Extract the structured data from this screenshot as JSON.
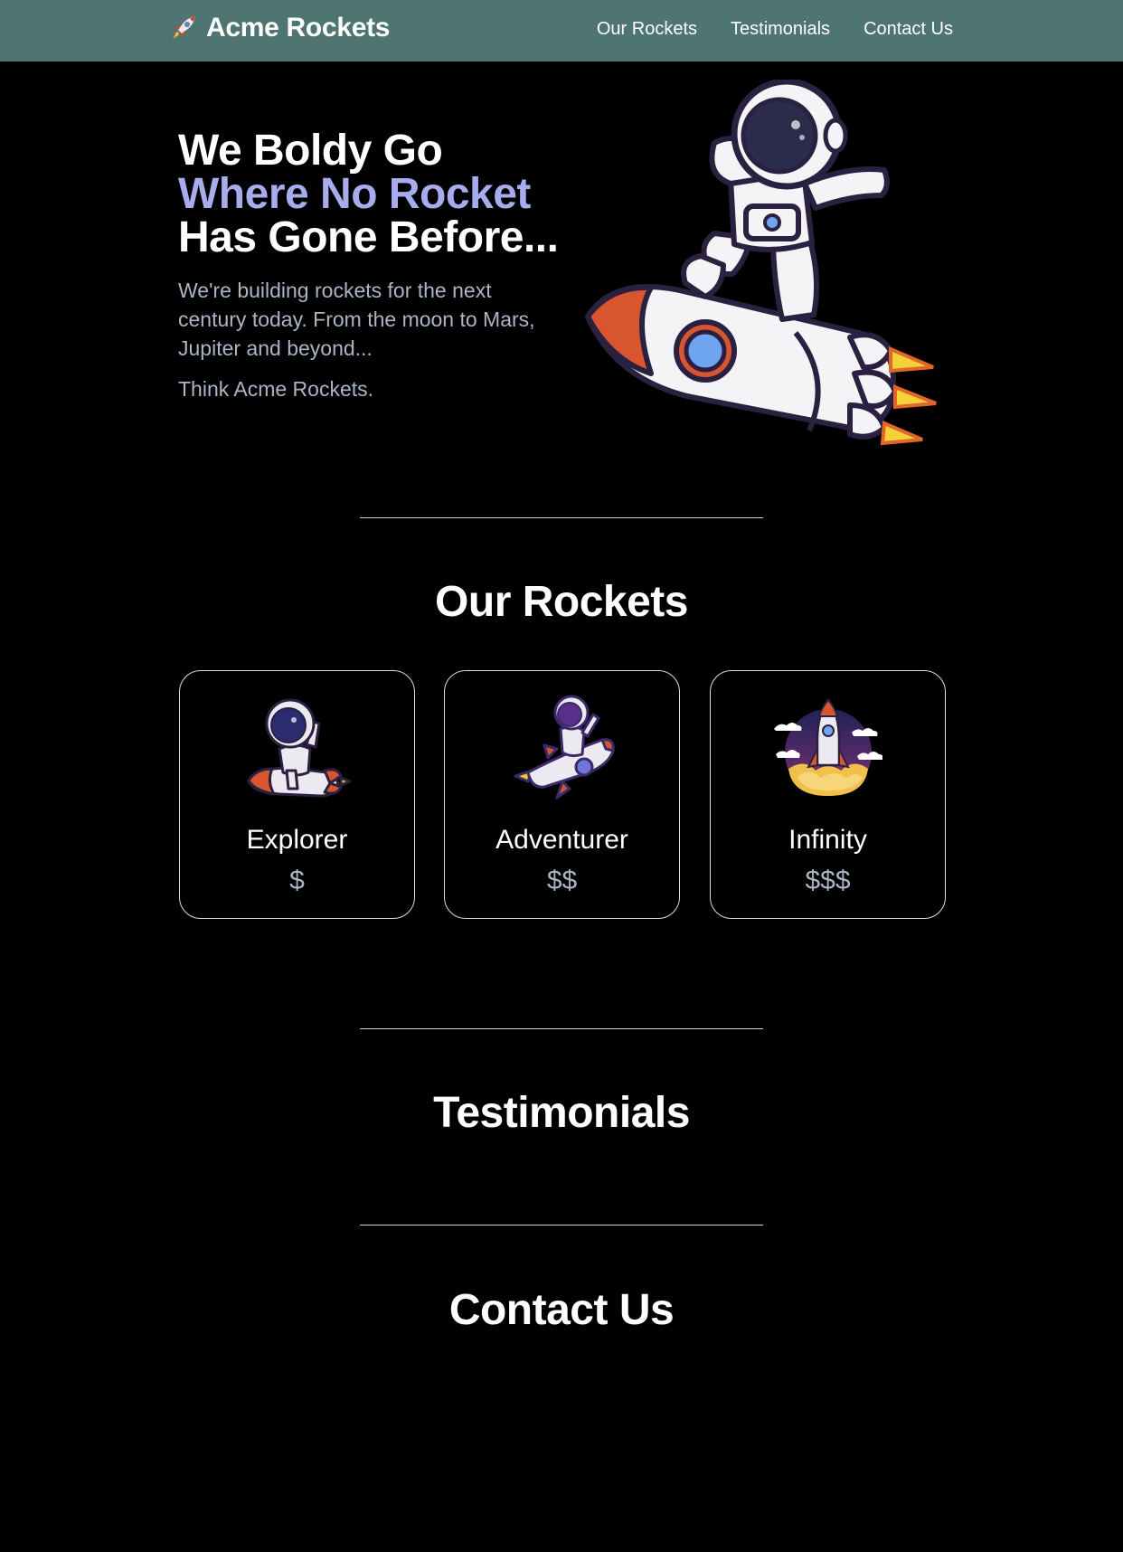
{
  "nav": {
    "brand": "Acme Rockets",
    "brand_icon": "rocket-icon",
    "links": [
      "Our Rockets",
      "Testimonials",
      "Contact Us"
    ]
  },
  "hero": {
    "line1": "We Boldy Go",
    "line2": "Where No Rocket",
    "line3": "Has Gone Before...",
    "description": "We're building rockets for the next century today. From the moon to Mars, Jupiter and beyond...",
    "tagline": "Think Acme Rockets.",
    "image": "astronaut-riding-rocket-illustration"
  },
  "sections": {
    "rockets": "Our Rockets",
    "testimonials": "Testimonials",
    "contact": "Contact Us"
  },
  "rockets": [
    {
      "name": "Explorer",
      "price": "$",
      "image": "astronaut-peace-sign-rocket-illustration"
    },
    {
      "name": "Adventurer",
      "price": "$$",
      "image": "astronaut-waving-rocket-illustration"
    },
    {
      "name": "Infinity",
      "price": "$$$",
      "image": "rocket-launch-illustration"
    }
  ],
  "colors": {
    "navbar": "#4e7571",
    "background": "#000000",
    "accent": "#a6acec",
    "muted_text": "#aab5c5"
  }
}
